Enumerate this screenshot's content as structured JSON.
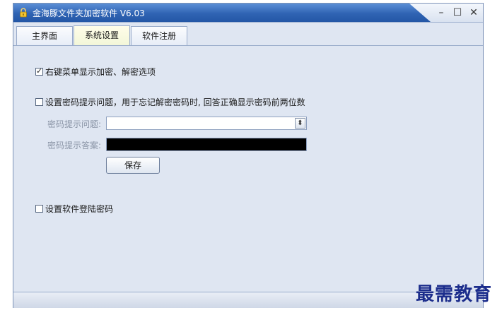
{
  "window": {
    "title": "金海豚文件夹加密软件 V6.03",
    "controls": {
      "minimize": "–",
      "maximize": "☐",
      "close": "✕"
    }
  },
  "tabs": [
    {
      "label": "主界面",
      "active": false
    },
    {
      "label": "系统设置",
      "active": true
    },
    {
      "label": "软件注册",
      "active": false
    }
  ],
  "settings": {
    "context_menu": {
      "label": "右键菜单显示加密、解密选项",
      "checked": true
    },
    "hint_question": {
      "label": "设置密码提示问题，用于忘记解密密码时, 回答正确显示密码前两位数",
      "checked": false
    },
    "question_label": "密码提示问题:",
    "question_value": "",
    "answer_label": "密码提示答案:",
    "save_label": "保存",
    "login_password": {
      "label": "设置软件登陆密码",
      "checked": false
    }
  },
  "watermark": "最需教育",
  "colors": {
    "title_bar": "#2f63b3",
    "window_bg": "#dfe6f2",
    "watermark": "#1c2d8c"
  }
}
